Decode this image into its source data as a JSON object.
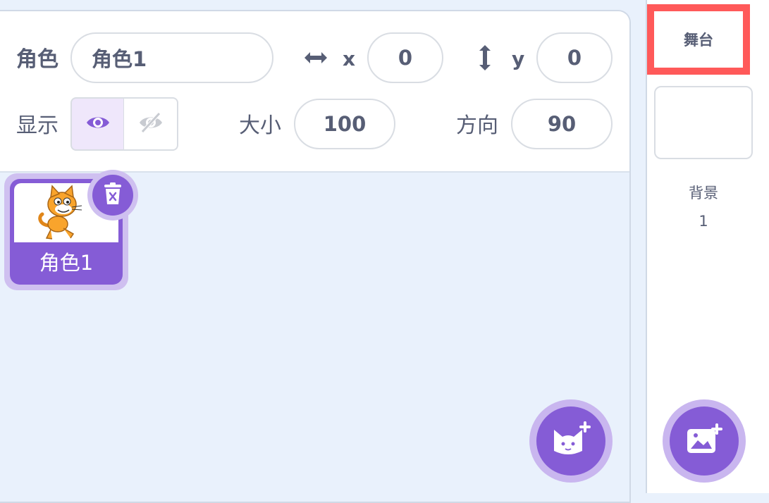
{
  "sprite_info": {
    "sprite_label": "角色",
    "sprite_name_value": "角色1",
    "x_label": "x",
    "x_value": "0",
    "y_label": "y",
    "y_value": "0",
    "show_label": "显示",
    "size_label": "大小",
    "size_value": "100",
    "direction_label": "方向",
    "direction_value": "90",
    "visible": true
  },
  "sprites": [
    {
      "name": "角色1",
      "selected": true
    }
  ],
  "stage": {
    "header_label": "舞台",
    "backdrop_label": "背景",
    "backdrop_count": "1"
  },
  "icons": {
    "x_arrow": "horizontal-arrows-icon",
    "y_arrow": "vertical-arrows-icon",
    "show": "eye-icon",
    "hide": "eye-slash-icon",
    "delete": "trash-icon",
    "add_sprite": "add-sprite-icon",
    "add_backdrop": "add-backdrop-icon"
  },
  "colors": {
    "accent": "#855cd6",
    "accent_light": "#cfc0f0",
    "highlight_border": "#ff5959",
    "text": "#575e75",
    "background": "#e9f1fc"
  }
}
